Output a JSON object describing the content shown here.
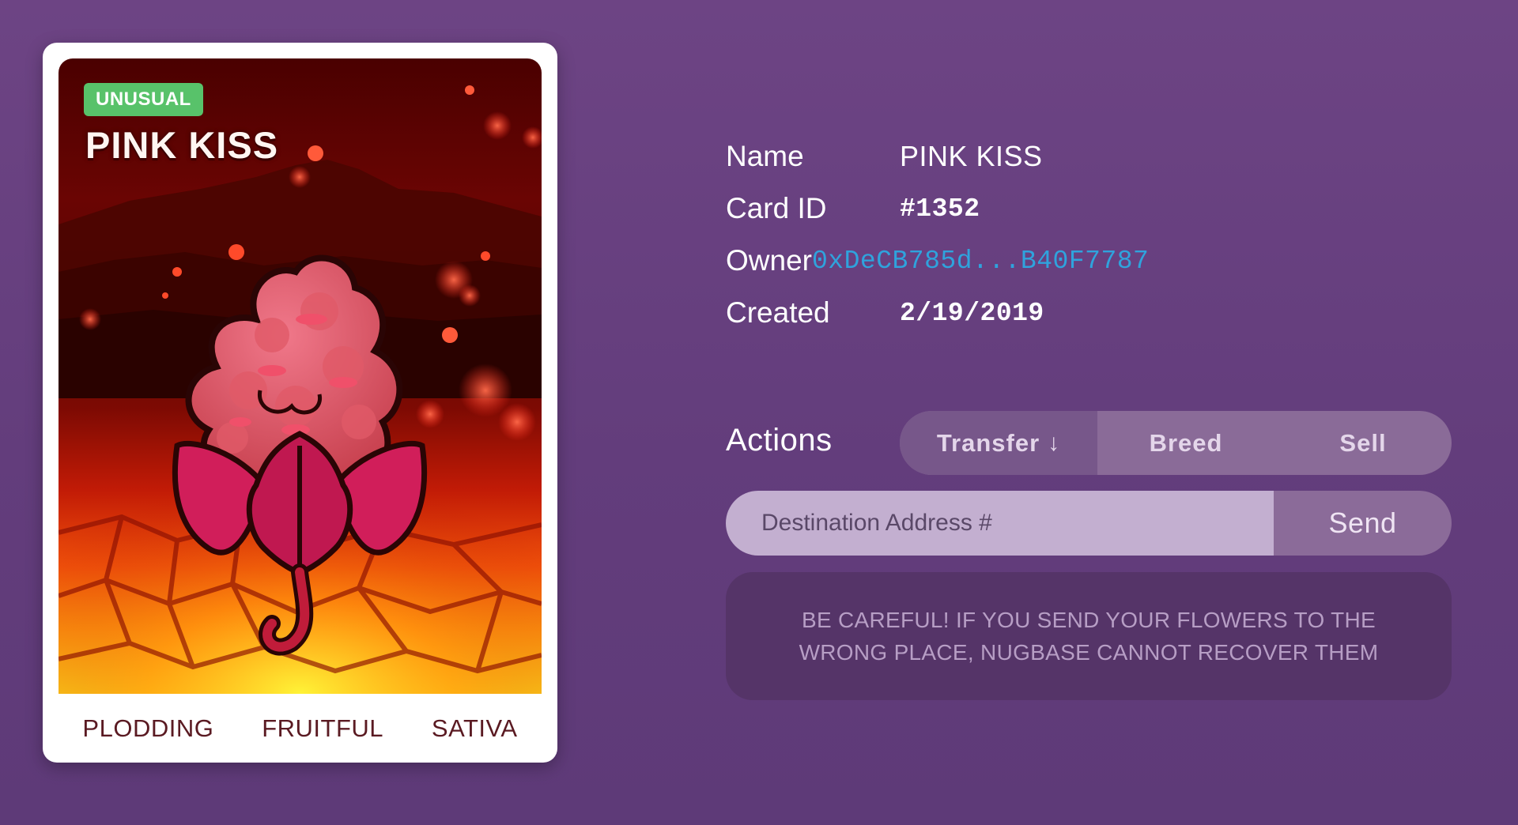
{
  "card": {
    "rarity": "UNUSUAL",
    "title": "PINK KISS",
    "traits": [
      "PLODDING",
      "FRUITFUL",
      "SATIVA"
    ],
    "art_icon": "pink-flower-on-lava-illustration",
    "colors": {
      "badge": "#58c26a",
      "title": "#fff6f2",
      "traits": "#5a1a22"
    }
  },
  "details": {
    "rows": [
      {
        "label": "Name",
        "value": "PINK KISS"
      },
      {
        "label": "Card ID",
        "value": "#1352"
      },
      {
        "label": "Owner",
        "value": "0xDeCB785d...B40F7787"
      },
      {
        "label": "Created",
        "value": "2/19/2019"
      }
    ],
    "owner_link_color": "#2fa3dd"
  },
  "actions": {
    "label": "Actions",
    "tabs": [
      {
        "label": "Transfer",
        "icon": "arrow-down-icon",
        "active": true
      },
      {
        "label": "Breed",
        "active": false
      },
      {
        "label": "Sell",
        "active": false
      }
    ],
    "arrow_glyph": "↓",
    "destination": {
      "placeholder": "Destination Address #",
      "value": ""
    },
    "send_label": "Send",
    "warning": "BE CAREFUL! IF YOU SEND YOUR FLOWERS TO THE WRONG PLACE, NUGBASE CANNOT RECOVER THEM"
  }
}
